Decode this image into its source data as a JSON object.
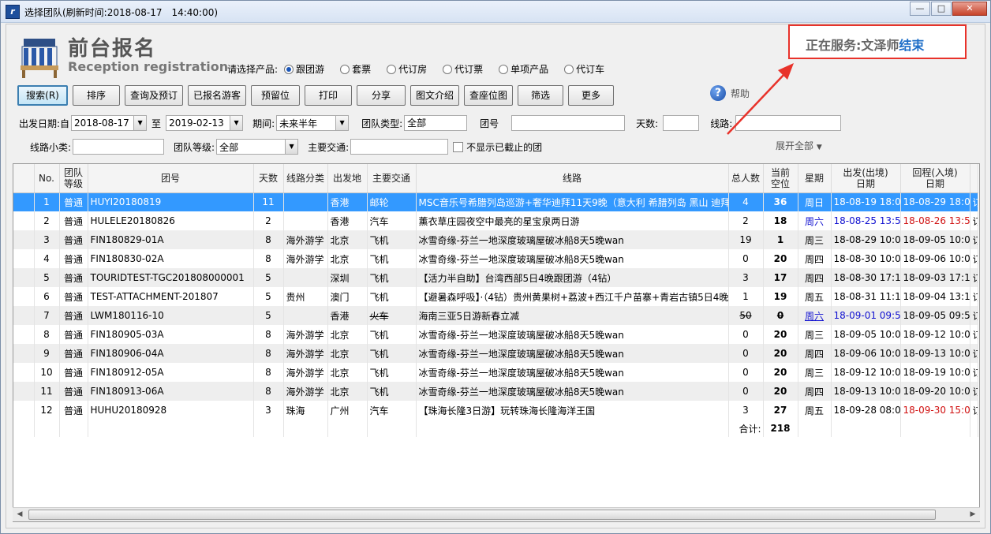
{
  "window": {
    "title": "选择团队(刷新时间:2018-08-17　14:40:00)",
    "app_icon_letter": "ri",
    "controls": [
      "minimize",
      "maximize",
      "close"
    ]
  },
  "header": {
    "title_cn": "前台报名",
    "title_en": "Reception registration",
    "service_label": "正在服务:文泽师",
    "service_end": "结束"
  },
  "product": {
    "label": "请选择产品:",
    "options": [
      "跟团游",
      "套票",
      "代订房",
      "代订票",
      "单项产品",
      "代订车"
    ],
    "selected_index": 0
  },
  "toolbar": {
    "buttons": [
      "搜索(R)",
      "排序",
      "查询及预订",
      "已报名游客",
      "预留位",
      "打印",
      "分享",
      "图文介绍",
      "查座位图",
      "筛选",
      "更多"
    ],
    "help": "帮助"
  },
  "filters": {
    "depart_label": "出发日期:自",
    "date_from": "2018-08-17",
    "to_label": "至",
    "date_to": "2019-02-13",
    "period_label": "期间:",
    "period_value": "未来半年",
    "group_type_label": "团队类型:",
    "group_type_value": "全部",
    "group_no_label": "团号",
    "group_no_value": "",
    "days_label": "天数:",
    "days_value": "",
    "route_label": "线路:",
    "route_value": "",
    "route_sub_label": "线路小类:",
    "route_sub_value": "",
    "group_level_label": "团队等级:",
    "group_level_value": "全部",
    "transport_label": "主要交通:",
    "transport_value": "",
    "hide_closed_label": "不显示已截止的团",
    "hide_closed_checked": false,
    "expand_all": "展开全部"
  },
  "table": {
    "columns": [
      "",
      "No.",
      "团队\n等级",
      "团号",
      "天数",
      "线路分类",
      "出发地",
      "主要交通",
      "线路",
      "总人数",
      "当前\n空位",
      "星期",
      "出发(出境)\n日期",
      "回程(入境)\n日期",
      ""
    ],
    "rows": [
      {
        "no": "1",
        "level": "普通",
        "code": "HUYI20180819",
        "days": "11",
        "category": "",
        "origin": "香港",
        "transport": "邮轮",
        "route": "MSC音乐号希腊列岛巡游+奢华迪拜11天9晚（意大利 希腊列岛 黑山 迪拜）",
        "total": "4",
        "vacancy": "36",
        "weekday": "周日",
        "depart": "18-08-19 18:06",
        "return": "18-08-29 18:06",
        "extra": "订"
      },
      {
        "no": "2",
        "level": "普通",
        "code": "HULELE20180826",
        "days": "2",
        "category": "",
        "origin": "香港",
        "transport": "汽车",
        "route": "薰衣草庄园夜空中最亮的星宝泉两日游",
        "total": "2",
        "vacancy": "18",
        "weekday": "周六",
        "depart": "18-08-25 13:54",
        "return": "18-08-26 13:54",
        "extra": "订"
      },
      {
        "no": "3",
        "level": "普通",
        "code": "FIN180829-01A",
        "days": "8",
        "category": "海外游学",
        "origin": "北京",
        "transport": "飞机",
        "route": "冰雪奇缘-芬兰一地深度玻璃屋破冰船8天5晚wan",
        "total": "19",
        "vacancy": "1",
        "weekday": "周三",
        "depart": "18-08-29 10:04",
        "return": "18-09-05 10:04",
        "extra": "订"
      },
      {
        "no": "4",
        "level": "普通",
        "code": "FIN180830-02A",
        "days": "8",
        "category": "海外游学",
        "origin": "北京",
        "transport": "飞机",
        "route": "冰雪奇缘-芬兰一地深度玻璃屋破冰船8天5晚wan",
        "total": "0",
        "vacancy": "20",
        "weekday": "周四",
        "depart": "18-08-30 10:04",
        "return": "18-09-06 10:04",
        "extra": "订"
      },
      {
        "no": "5",
        "level": "普通",
        "code": "TOURIDTEST-TGC201808000001",
        "days": "5",
        "category": "",
        "origin": "深圳",
        "transport": "飞机",
        "route": "【活力半自助】台湾西部5日4晚跟团游（4钻）",
        "total": "3",
        "vacancy": "17",
        "weekday": "周四",
        "depart": "18-08-30 17:18",
        "return": "18-09-03 17:18",
        "extra": "订"
      },
      {
        "no": "6",
        "level": "普通",
        "code": "TEST-ATTACHMENT-201807",
        "days": "5",
        "category": "贵州",
        "origin": "澳门",
        "transport": "飞机",
        "route": "【避暑森呼吸】·（4钻）贵州黄果树+荔波+西江千户苗寨+青岩古镇5日4晚",
        "total": "1",
        "vacancy": "19",
        "weekday": "周五",
        "depart": "18-08-31 11:18",
        "return": "18-09-04 13:18",
        "extra": "订"
      },
      {
        "no": "7",
        "level": "普通",
        "code": "LWM180116-10",
        "days": "5",
        "category": "",
        "origin": "香港",
        "transport": "火车",
        "route": "海南三亚5日游新春立减",
        "total": "50",
        "vacancy": "0",
        "weekday": "周六",
        "depart": "18-09-01 09:54",
        "return": "18-09-05 09:54",
        "extra": "订"
      },
      {
        "no": "8",
        "level": "普通",
        "code": "FIN180905-03A",
        "days": "8",
        "category": "海外游学",
        "origin": "北京",
        "transport": "飞机",
        "route": "冰雪奇缘-芬兰一地深度玻璃屋破冰船8天5晚wan",
        "total": "0",
        "vacancy": "20",
        "weekday": "周三",
        "depart": "18-09-05 10:04",
        "return": "18-09-12 10:04",
        "extra": "订"
      },
      {
        "no": "9",
        "level": "普通",
        "code": "FIN180906-04A",
        "days": "8",
        "category": "海外游学",
        "origin": "北京",
        "transport": "飞机",
        "route": "冰雪奇缘-芬兰一地深度玻璃屋破冰船8天5晚wan",
        "total": "0",
        "vacancy": "20",
        "weekday": "周四",
        "depart": "18-09-06 10:04",
        "return": "18-09-13 10:04",
        "extra": "订"
      },
      {
        "no": "10",
        "level": "普通",
        "code": "FIN180912-05A",
        "days": "8",
        "category": "海外游学",
        "origin": "北京",
        "transport": "飞机",
        "route": "冰雪奇缘-芬兰一地深度玻璃屋破冰船8天5晚wan",
        "total": "0",
        "vacancy": "20",
        "weekday": "周三",
        "depart": "18-09-12 10:04",
        "return": "18-09-19 10:04",
        "extra": "订"
      },
      {
        "no": "11",
        "level": "普通",
        "code": "FIN180913-06A",
        "days": "8",
        "category": "海外游学",
        "origin": "北京",
        "transport": "飞机",
        "route": "冰雪奇缘-芬兰一地深度玻璃屋破冰船8天5晚wan",
        "total": "0",
        "vacancy": "20",
        "weekday": "周四",
        "depart": "18-09-13 10:04",
        "return": "18-09-20 10:04",
        "extra": "订"
      },
      {
        "no": "12",
        "level": "普通",
        "code": "HUHU20180928",
        "days": "3",
        "category": "珠海",
        "origin": "广州",
        "transport": "汽车",
        "route": "【珠海长隆3日游】玩转珠海长隆海洋王国",
        "total": "3",
        "vacancy": "27",
        "weekday": "周五",
        "depart": "18-09-28 08:00",
        "return": "18-09-30 15:00",
        "extra": "订"
      }
    ],
    "selected_row": 0,
    "summary_label": "合计:",
    "summary_vacancy": "218"
  },
  "colors": {
    "selection": "#3399ff",
    "annotation_red": "#e8322a",
    "service_end_blue": "#1f6fc8",
    "date_blue": "#1010d0",
    "date_red": "#d01010"
  }
}
